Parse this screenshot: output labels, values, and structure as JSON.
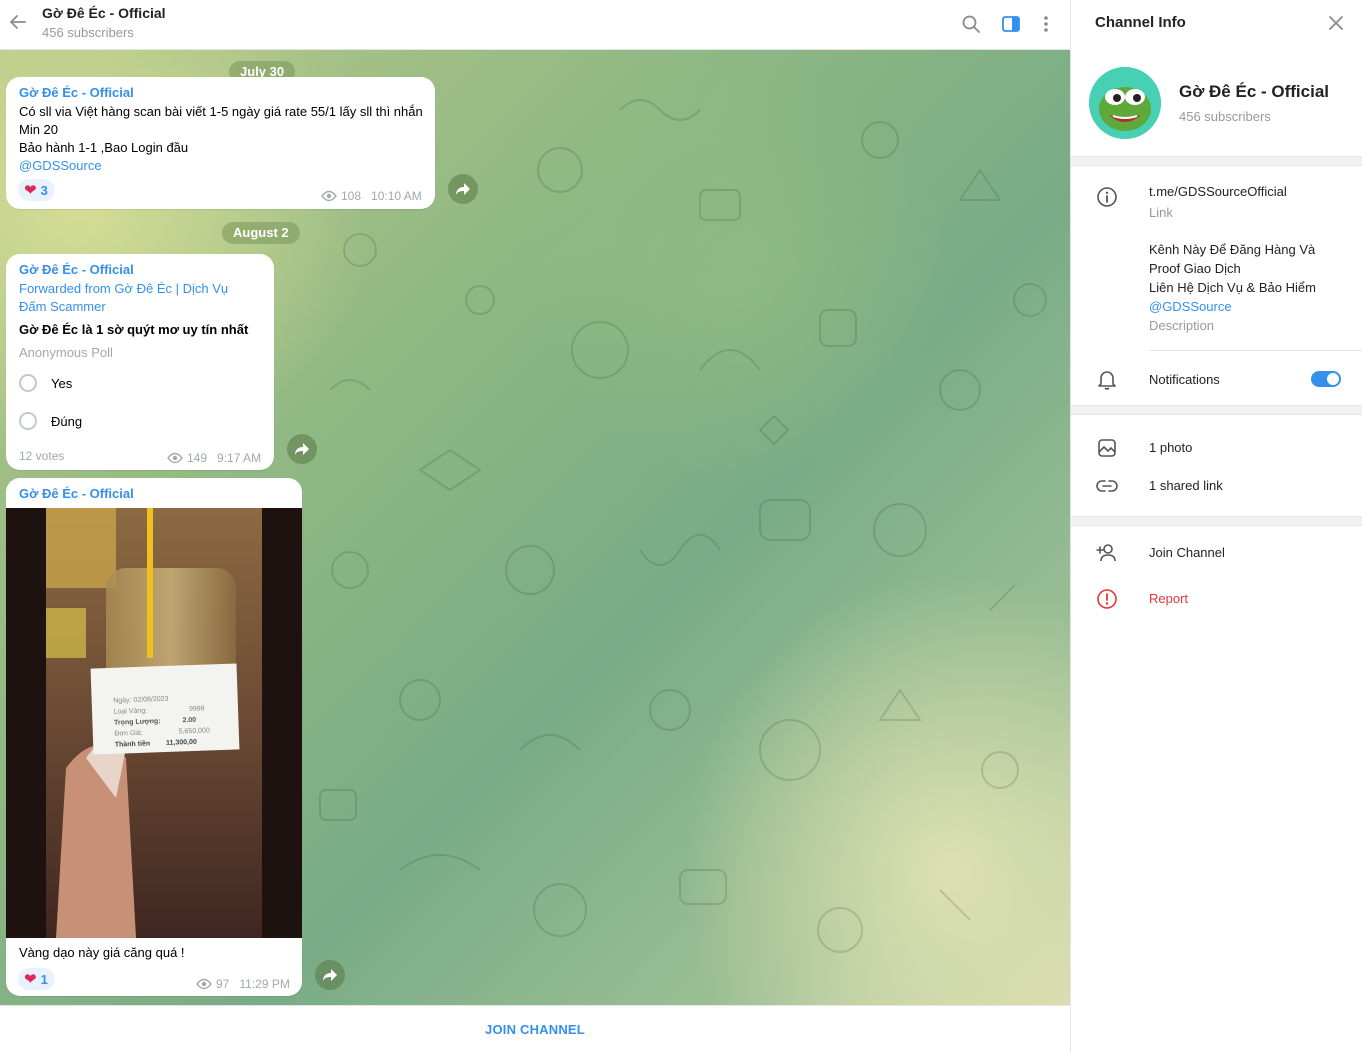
{
  "header": {
    "title": "Gờ Đê Éc - Official",
    "subtitle": "456 subscribers",
    "icons": [
      "back-arrow-icon",
      "search-icon",
      "sidebar-toggle-icon",
      "more-vertical-icon"
    ]
  },
  "dates": [
    "July 30",
    "August 2"
  ],
  "messages": [
    {
      "sender": "Gờ Đê Éc - Official",
      "lines": [
        "Có sll via Việt hàng scan bài viết 1-5 ngày giá rate 55/1 lấy sll thì nhắn",
        "Min 20",
        "Bảo hành 1-1 ,Bao Login đầu"
      ],
      "mention": "@GDSSource",
      "reaction": "3",
      "views": "108",
      "time": "10:10 AM"
    },
    {
      "sender": "Gờ Đê Éc - Official",
      "forwarded_line1": "Forwarded from Gờ Đê Éc | Dịch Vụ",
      "forwarded_line2": "Đấm Scammer",
      "poll_question": "Gờ Đê Éc là 1 sờ quýt mơ uy tín nhất",
      "poll_type": "Anonymous Poll",
      "options": [
        "Yes",
        "Đúng"
      ],
      "votes": "12 votes",
      "views": "149",
      "time": "9:17 AM"
    },
    {
      "sender": "Gờ Đê Éc - Official",
      "receipt": {
        "date_label": "Ngày:",
        "date_value": "02/08/2023",
        "type_label": "Loại Vàng:",
        "type_value": "9999",
        "weight_label": "Trọng Lượng:",
        "weight_value": "2.00",
        "price_label": "Đơn Giá:",
        "price_value": "5,650,000",
        "total_label": "Thành tiền",
        "total_value": "11,300,00"
      },
      "caption": "Vàng dạo này giá căng quá !",
      "reaction": "1",
      "views": "97",
      "time": "11:29 PM"
    }
  ],
  "join_label": "JOIN CHANNEL",
  "info": {
    "panel_title": "Channel Info",
    "name": "Gờ Đê Éc - Official",
    "subscribers": "456 subscribers",
    "link": "t.me/GDSSourceOfficial",
    "link_label": "Link",
    "description_lines": [
      "Kênh Này Để Đăng Hàng Và",
      "Proof Giao Dịch",
      "Liên Hệ Dịch Vụ & Bảo Hiểm"
    ],
    "description_mention": "@GDSSource",
    "description_label": "Description",
    "notifications_label": "Notifications",
    "notifications_on": true,
    "photos": "1 photo",
    "shared_links": "1 shared link",
    "join": "Join Channel",
    "report": "Report"
  },
  "colors": {
    "accent": "#3390ec",
    "danger": "#e53935",
    "heart": "#e0245e"
  }
}
